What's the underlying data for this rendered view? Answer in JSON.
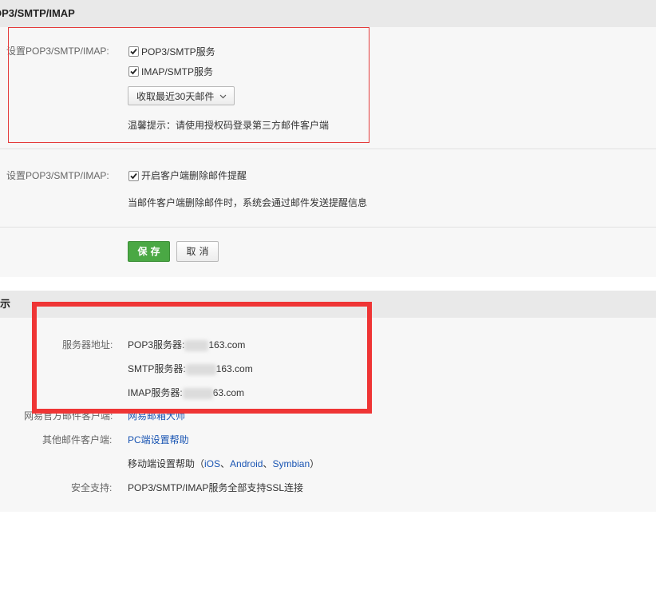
{
  "pop_section": {
    "header": "OP3/SMTP/IMAP",
    "setting1": {
      "label": "设置POP3/SMTP/IMAP:",
      "pop3_smtp": {
        "label": "POP3/SMTP服务",
        "checked": true
      },
      "imap_smtp": {
        "label": "IMAP/SMTP服务",
        "checked": true
      },
      "fetch_select": "收取最近30天邮件",
      "tip": "温馨提示：请使用授权码登录第三方邮件客户端"
    },
    "setting2": {
      "label": "设置POP3/SMTP/IMAP:",
      "delete_notify": {
        "label": "开启客户端删除邮件提醒",
        "checked": true
      },
      "desc": "当邮件客户端删除邮件时，系统会通过邮件发送提醒信息"
    },
    "save_label": "保存",
    "cancel_label": "取消"
  },
  "client_section": {
    "header": "示",
    "server_label": "服务器地址:",
    "pop3_prefix": "POP3服务器:",
    "pop3_suffix": "163.com",
    "smtp_prefix": "SMTP服务器:",
    "smtp_suffix": "163.com",
    "imap_prefix": "IMAP服务器:",
    "imap_suffix": "63.com",
    "netease_label": "网易官方邮件客户端:",
    "netease_link": "网易邮箱大师",
    "other_label": "其他邮件客户端:",
    "pc_help": "PC端设置帮助",
    "mobile_help_prefix": "移动端设置帮助（",
    "mobile_ios": "iOS",
    "sep1": "、",
    "mobile_android": "Android",
    "sep2": "、",
    "mobile_symbian": "Symbian",
    "mobile_help_suffix": "）",
    "security_label": "安全支持:",
    "security_value": "POP3/SMTP/IMAP服务全部支持SSL连接"
  },
  "colors": {
    "accent_green": "#4aa844",
    "link_blue": "#1a55b3",
    "annotation_red": "#ef3535"
  }
}
